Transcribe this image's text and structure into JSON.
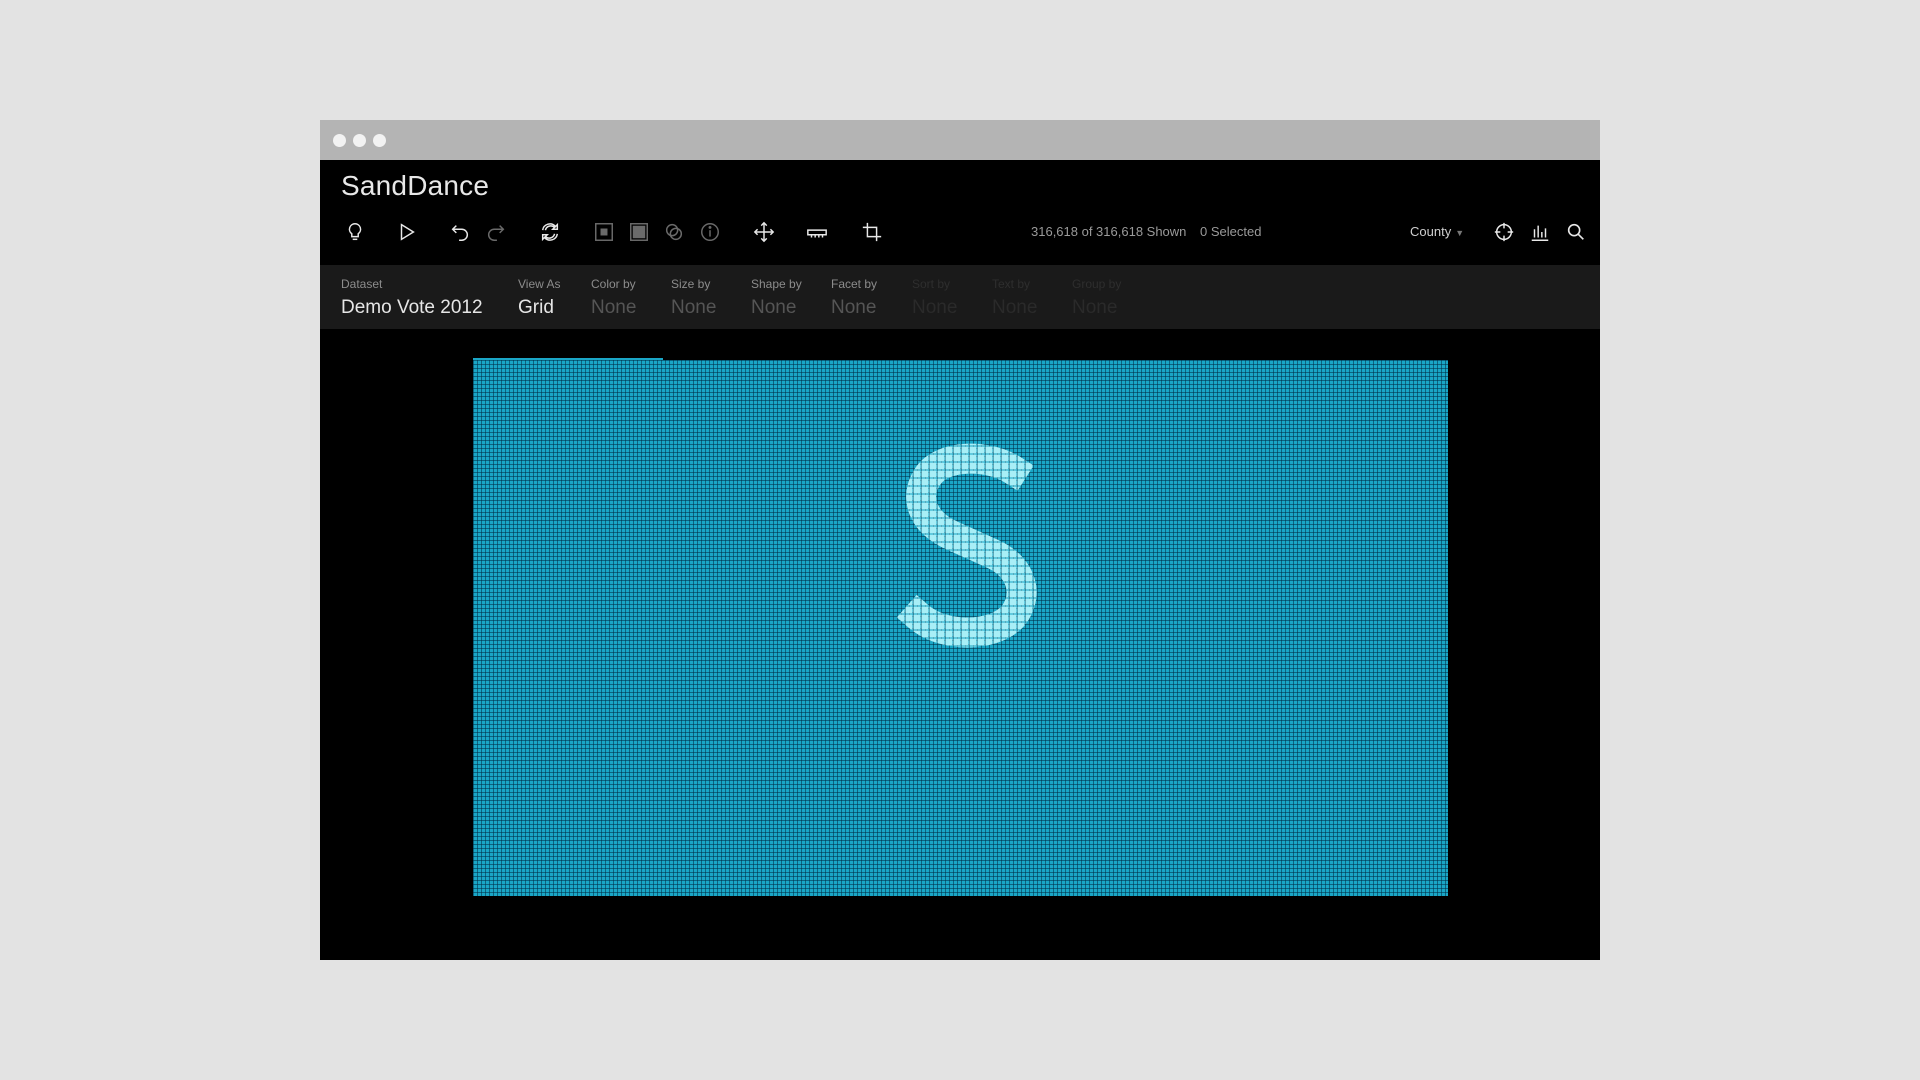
{
  "app": {
    "title": "SandDance"
  },
  "toolbar": {
    "icons": [
      "lightbulb-icon",
      "play-icon",
      "undo-icon",
      "redo-icon",
      "refresh-icon",
      "select-square-icon",
      "filled-square-icon",
      "exclude-icon",
      "info-icon",
      "move-icon",
      "ruler-icon",
      "crop-icon"
    ],
    "shown_text": "316,618 of 316,618 Shown",
    "selected_text": "0 Selected",
    "search_column": "County",
    "right_icons": [
      "crosshair-icon",
      "bar-chart-icon",
      "search-icon"
    ]
  },
  "properties": {
    "dataset": {
      "label": "Dataset",
      "value": "Demo Vote 2012"
    },
    "view_as": {
      "label": "View As",
      "value": "Grid"
    },
    "color_by": {
      "label": "Color by",
      "value": "None"
    },
    "size_by": {
      "label": "Size by",
      "value": "None"
    },
    "shape_by": {
      "label": "Shape by",
      "value": "None"
    },
    "facet_by": {
      "label": "Facet by",
      "value": "None"
    },
    "sort_by": {
      "label": "Sort by",
      "value": "None"
    },
    "text_by": {
      "label": "Text by",
      "value": "None"
    },
    "group_by": {
      "label": "Group by",
      "value": "None"
    }
  },
  "colors": {
    "grid_fill": "#1aa6c6",
    "highlight": "#a8eef6",
    "background": "#000000"
  }
}
